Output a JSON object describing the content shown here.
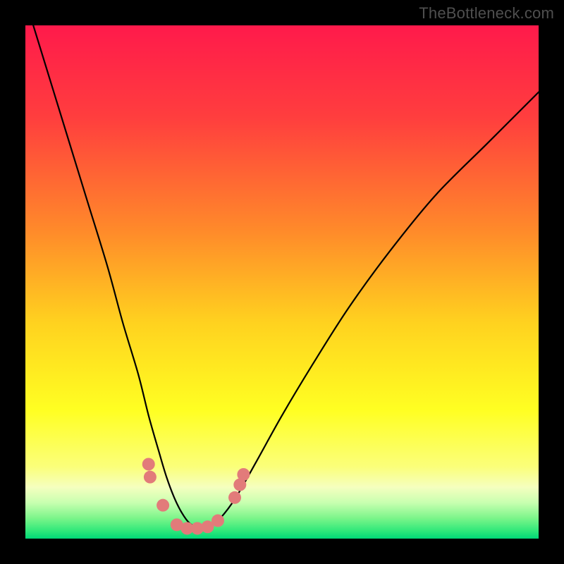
{
  "watermark": "TheBottleneck.com",
  "chart_data": {
    "type": "line",
    "title": "",
    "xlabel": "",
    "ylabel": "",
    "xlim": [
      0,
      100
    ],
    "ylim": [
      0,
      100
    ],
    "legend": false,
    "grid": false,
    "gradient_stops": [
      {
        "pos": 0.0,
        "color": "#ff1a4b"
      },
      {
        "pos": 0.18,
        "color": "#ff3e3e"
      },
      {
        "pos": 0.4,
        "color": "#ff8a2a"
      },
      {
        "pos": 0.58,
        "color": "#ffd21f"
      },
      {
        "pos": 0.75,
        "color": "#ffff22"
      },
      {
        "pos": 0.86,
        "color": "#fbff7a"
      },
      {
        "pos": 0.9,
        "color": "#f5ffbf"
      },
      {
        "pos": 0.93,
        "color": "#c8ffb0"
      },
      {
        "pos": 0.96,
        "color": "#7cf58a"
      },
      {
        "pos": 0.985,
        "color": "#2fe87a"
      },
      {
        "pos": 1.0,
        "color": "#00d877"
      }
    ],
    "series": [
      {
        "name": "bottleneck-curve",
        "stroke": "#000000",
        "x": [
          0,
          4,
          8,
          12,
          16,
          19,
          22,
          24,
          26,
          27.5,
          29,
          30.5,
          32,
          34,
          36,
          38,
          41,
          45,
          50,
          56,
          63,
          71,
          80,
          90,
          100
        ],
        "values": [
          105,
          92,
          79,
          66,
          53,
          42,
          32,
          24,
          17,
          12,
          8,
          5,
          3,
          2,
          2.5,
          4,
          8,
          15,
          24,
          34,
          45,
          56,
          67,
          77,
          87
        ]
      }
    ],
    "markers": {
      "name": "highlight-dots",
      "color": "#e27b7a",
      "radius_px": 9,
      "points": [
        {
          "x": 24.0,
          "y": 14.5
        },
        {
          "x": 24.3,
          "y": 12.0
        },
        {
          "x": 26.8,
          "y": 6.5
        },
        {
          "x": 29.5,
          "y": 2.7
        },
        {
          "x": 31.5,
          "y": 2.0
        },
        {
          "x": 33.5,
          "y": 2.0
        },
        {
          "x": 35.5,
          "y": 2.3
        },
        {
          "x": 37.5,
          "y": 3.5
        },
        {
          "x": 40.8,
          "y": 8.0
        },
        {
          "x": 41.8,
          "y": 10.5
        },
        {
          "x": 42.5,
          "y": 12.5
        }
      ]
    }
  }
}
